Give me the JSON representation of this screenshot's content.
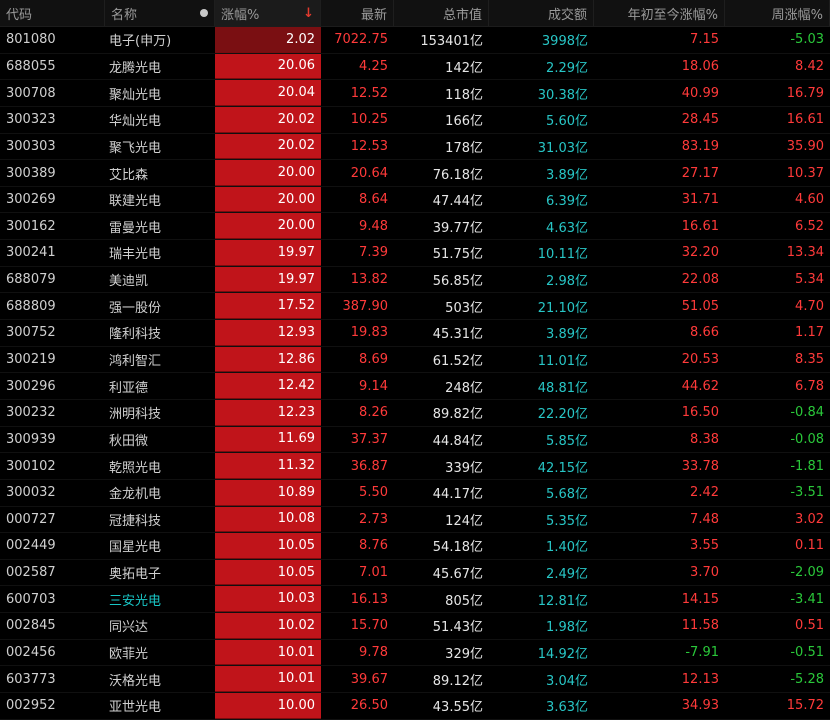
{
  "headers": {
    "code": "代码",
    "name": "名称",
    "change": "涨幅%",
    "price": "最新",
    "mcap": "总市值",
    "volume": "成交额",
    "ytd": "年初至今涨幅%",
    "week": "周涨幅%"
  },
  "rows": [
    {
      "code": "801080",
      "name": "电子(申万)",
      "change": "2.02",
      "price": "7022.75",
      "mcap": "153401亿",
      "volume": "3998亿",
      "ytd": "7.15",
      "week": "-5.03"
    },
    {
      "code": "688055",
      "name": "龙腾光电",
      "change": "20.06",
      "price": "4.25",
      "mcap": "142亿",
      "volume": "2.29亿",
      "ytd": "18.06",
      "week": "8.42"
    },
    {
      "code": "300708",
      "name": "聚灿光电",
      "change": "20.04",
      "price": "12.52",
      "mcap": "118亿",
      "volume": "30.38亿",
      "ytd": "40.99",
      "week": "16.79"
    },
    {
      "code": "300323",
      "name": "华灿光电",
      "change": "20.02",
      "price": "10.25",
      "mcap": "166亿",
      "volume": "5.60亿",
      "ytd": "28.45",
      "week": "16.61"
    },
    {
      "code": "300303",
      "name": "聚飞光电",
      "change": "20.02",
      "price": "12.53",
      "mcap": "178亿",
      "volume": "31.03亿",
      "ytd": "83.19",
      "week": "35.90"
    },
    {
      "code": "300389",
      "name": "艾比森",
      "change": "20.00",
      "price": "20.64",
      "mcap": "76.18亿",
      "volume": "3.89亿",
      "ytd": "27.17",
      "week": "10.37"
    },
    {
      "code": "300269",
      "name": "联建光电",
      "change": "20.00",
      "price": "8.64",
      "mcap": "47.44亿",
      "volume": "6.39亿",
      "ytd": "31.71",
      "week": "4.60"
    },
    {
      "code": "300162",
      "name": "雷曼光电",
      "change": "20.00",
      "price": "9.48",
      "mcap": "39.77亿",
      "volume": "4.63亿",
      "ytd": "16.61",
      "week": "6.52"
    },
    {
      "code": "300241",
      "name": "瑞丰光电",
      "change": "19.97",
      "price": "7.39",
      "mcap": "51.75亿",
      "volume": "10.11亿",
      "ytd": "32.20",
      "week": "13.34"
    },
    {
      "code": "688079",
      "name": "美迪凯",
      "change": "19.97",
      "price": "13.82",
      "mcap": "56.85亿",
      "volume": "2.98亿",
      "ytd": "22.08",
      "week": "5.34"
    },
    {
      "code": "688809",
      "name": "强一股份",
      "change": "17.52",
      "price": "387.90",
      "mcap": "503亿",
      "volume": "21.10亿",
      "ytd": "51.05",
      "week": "4.70"
    },
    {
      "code": "300752",
      "name": "隆利科技",
      "change": "12.93",
      "price": "19.83",
      "mcap": "45.31亿",
      "volume": "3.89亿",
      "ytd": "8.66",
      "week": "1.17"
    },
    {
      "code": "300219",
      "name": "鸿利智汇",
      "change": "12.86",
      "price": "8.69",
      "mcap": "61.52亿",
      "volume": "11.01亿",
      "ytd": "20.53",
      "week": "8.35"
    },
    {
      "code": "300296",
      "name": "利亚德",
      "change": "12.42",
      "price": "9.14",
      "mcap": "248亿",
      "volume": "48.81亿",
      "ytd": "44.62",
      "week": "6.78"
    },
    {
      "code": "300232",
      "name": "洲明科技",
      "change": "12.23",
      "price": "8.26",
      "mcap": "89.82亿",
      "volume": "22.20亿",
      "ytd": "16.50",
      "week": "-0.84"
    },
    {
      "code": "300939",
      "name": "秋田微",
      "change": "11.69",
      "price": "37.37",
      "mcap": "44.84亿",
      "volume": "5.85亿",
      "ytd": "8.38",
      "week": "-0.08"
    },
    {
      "code": "300102",
      "name": "乾照光电",
      "change": "11.32",
      "price": "36.87",
      "mcap": "339亿",
      "volume": "42.15亿",
      "ytd": "33.78",
      "week": "-1.81"
    },
    {
      "code": "300032",
      "name": "金龙机电",
      "change": "10.89",
      "price": "5.50",
      "mcap": "44.17亿",
      "volume": "5.68亿",
      "ytd": "2.42",
      "week": "-3.51"
    },
    {
      "code": "000727",
      "name": "冠捷科技",
      "change": "10.08",
      "price": "2.73",
      "mcap": "124亿",
      "volume": "5.35亿",
      "ytd": "7.48",
      "week": "3.02"
    },
    {
      "code": "002449",
      "name": "国星光电",
      "change": "10.05",
      "price": "8.76",
      "mcap": "54.18亿",
      "volume": "1.40亿",
      "ytd": "3.55",
      "week": "0.11"
    },
    {
      "code": "002587",
      "name": "奥拓电子",
      "change": "10.05",
      "price": "7.01",
      "mcap": "45.67亿",
      "volume": "2.49亿",
      "ytd": "3.70",
      "week": "-2.09"
    },
    {
      "code": "600703",
      "name": "三安光电",
      "change": "10.03",
      "price": "16.13",
      "mcap": "805亿",
      "volume": "12.81亿",
      "ytd": "14.15",
      "week": "-3.41"
    },
    {
      "code": "002845",
      "name": "同兴达",
      "change": "10.02",
      "price": "15.70",
      "mcap": "51.43亿",
      "volume": "1.98亿",
      "ytd": "11.58",
      "week": "0.51"
    },
    {
      "code": "002456",
      "name": "欧菲光",
      "change": "10.01",
      "price": "9.78",
      "mcap": "329亿",
      "volume": "14.92亿",
      "ytd": "-7.91",
      "week": "-0.51"
    },
    {
      "code": "603773",
      "name": "沃格光电",
      "change": "10.01",
      "price": "39.67",
      "mcap": "89.12亿",
      "volume": "3.04亿",
      "ytd": "12.13",
      "week": "-5.28"
    },
    {
      "code": "002952",
      "name": "亚世光电",
      "change": "10.00",
      "price": "26.50",
      "mcap": "43.55亿",
      "volume": "3.63亿",
      "ytd": "34.93",
      "week": "15.72"
    }
  ],
  "highlight_row_name": "三安光电",
  "colors": {
    "up": "#ff3a3a",
    "down": "#2ac83a",
    "volume": "#28c6c6",
    "change_cell": "#c0141a"
  }
}
